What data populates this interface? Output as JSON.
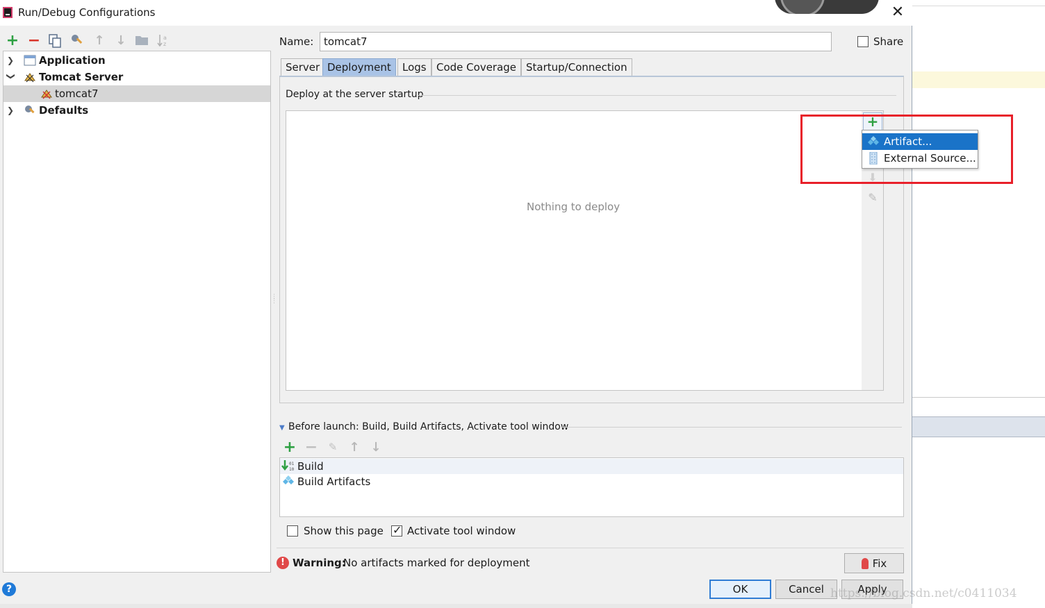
{
  "window": {
    "title": "Run/Debug Configurations",
    "close_symbol": "✕"
  },
  "toolbar": {
    "icons": [
      "add-icon",
      "remove-icon",
      "copy-icon",
      "edit-defaults-icon",
      "move-up-icon",
      "move-down-icon",
      "folder-icon",
      "sort-icon"
    ],
    "add_symbol": "+",
    "remove_symbol": "−",
    "up_symbol": "↑",
    "down_symbol": "↓"
  },
  "tree": {
    "items": [
      {
        "label": "Application",
        "expanded": false
      },
      {
        "label": "Tomcat Server",
        "expanded": true
      },
      {
        "label": "tomcat7",
        "selected": true
      },
      {
        "label": "Defaults",
        "expanded": false
      }
    ]
  },
  "form": {
    "name_label": "Name:",
    "name_value": "tomcat7",
    "share_label": "Share",
    "share_checked": false
  },
  "tabs": [
    {
      "label": "Server"
    },
    {
      "label": "Deployment",
      "active": true
    },
    {
      "label": "Logs"
    },
    {
      "label": "Code Coverage"
    },
    {
      "label": "Startup/Connection"
    }
  ],
  "deployment": {
    "section_title": "Deploy at the server startup",
    "empty_text": "Nothing to deploy",
    "add_symbol": "+"
  },
  "popup_menu": {
    "items": [
      {
        "label": "Artifact...",
        "selected": true
      },
      {
        "label": "External Source..."
      }
    ]
  },
  "before_launch": {
    "title": "Before launch: Build, Build Artifacts, Activate tool window",
    "items": [
      {
        "label": "Build"
      },
      {
        "label": "Build Artifacts"
      }
    ],
    "show_page_label": "Show this page",
    "show_page_checked": false,
    "activate_label": "Activate tool window",
    "activate_checked": true
  },
  "warning": {
    "bold": "Warning:",
    "text": "No artifacts marked for deployment",
    "fix_label": "Fix"
  },
  "buttons": {
    "ok": "OK",
    "cancel": "Cancel",
    "apply": "Apply",
    "help": "?"
  },
  "watermark": "https://blog.csdn.net/c0411034",
  "colors": {
    "accent": "#2f7cd4",
    "menu_selection": "#1a73c8",
    "active_tab": "#a9c3e6",
    "highlight_box": "#e8202a",
    "add_green": "#2ea043",
    "remove_red": "#d9352b"
  }
}
